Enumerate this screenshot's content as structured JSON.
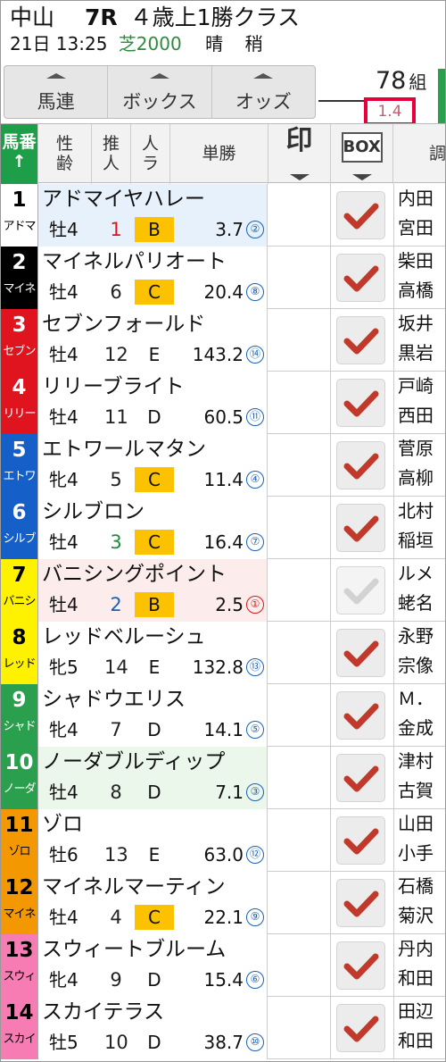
{
  "race": {
    "venue": "中山",
    "number": "7R",
    "cls": "４歳上1勝クラス",
    "date_time": "21日 13:25",
    "course": "芝2000",
    "weather": "晴",
    "track": "稍"
  },
  "toolbar": {
    "umaren": "馬連",
    "box": "ボックス",
    "odds": "オッズ"
  },
  "combos": {
    "count": "78",
    "unit": "組",
    "odds": "1.4"
  },
  "columns": {
    "umaban": "馬番↑",
    "seirei_1": "性",
    "seirei_2": "齢",
    "suijin_1": "推",
    "suijin_2": "人",
    "jinki_1": "人",
    "jinki_2": "ラ",
    "tansho": "単勝",
    "shirushi": "印",
    "box": "BOX",
    "jockey": "調"
  },
  "horses": [
    {
      "num": "1",
      "short": "アドマ",
      "name": "アドマイヤハレー",
      "sex_age": "牡4",
      "pop": "1",
      "rank": "B",
      "odds": "3.7",
      "ord": "②",
      "jockey": "内田",
      "trainer": "宮田",
      "color": "#ffffff",
      "fg": "#000",
      "bg": "#e6f1fb",
      "pop_color": "#d81818",
      "ord_red": false,
      "checked": true
    },
    {
      "num": "2",
      "short": "マイネ",
      "name": "マイネルパリオート",
      "sex_age": "牡4",
      "pop": "6",
      "rank": "C",
      "odds": "20.4",
      "ord": "⑧",
      "jockey": "柴田",
      "trainer": "高橋",
      "color": "#000000",
      "fg": "#fff",
      "bg": "#fff",
      "pop_color": "#222",
      "ord_red": false,
      "checked": true
    },
    {
      "num": "3",
      "short": "セブン",
      "name": "セブンフォールド",
      "sex_age": "牡4",
      "pop": "12",
      "rank": "E",
      "odds": "143.2",
      "ord": "⑭",
      "jockey": "坂井",
      "trainer": "黒岩",
      "color": "#e0141e",
      "fg": "#fff",
      "bg": "#fff",
      "pop_color": "#222",
      "ord_red": false,
      "checked": true
    },
    {
      "num": "4",
      "short": "リリー",
      "name": "リリーブライト",
      "sex_age": "牡4",
      "pop": "11",
      "rank": "D",
      "odds": "60.5",
      "ord": "⑪",
      "jockey": "戸崎",
      "trainer": "西田",
      "color": "#e0141e",
      "fg": "#fff",
      "bg": "#fff",
      "pop_color": "#222",
      "ord_red": false,
      "checked": true
    },
    {
      "num": "5",
      "short": "エトワ",
      "name": "エトワールマタン",
      "sex_age": "牝4",
      "pop": "5",
      "rank": "C",
      "odds": "11.4",
      "ord": "④",
      "jockey": "菅原",
      "trainer": "高柳",
      "color": "#1560c8",
      "fg": "#fff",
      "bg": "#fff",
      "pop_color": "#222",
      "ord_red": false,
      "checked": true
    },
    {
      "num": "6",
      "short": "シルブ",
      "name": "シルブロン",
      "sex_age": "牡4",
      "pop": "3",
      "rank": "C",
      "odds": "16.4",
      "ord": "⑦",
      "jockey": "北村",
      "trainer": "稲垣",
      "color": "#1560c8",
      "fg": "#fff",
      "bg": "#fff",
      "pop_color": "#1e8c3a",
      "ord_red": false,
      "checked": true
    },
    {
      "num": "7",
      "short": "バニシ",
      "name": "バニシングポイント",
      "sex_age": "牡4",
      "pop": "2",
      "rank": "B",
      "odds": "2.5",
      "ord": "①",
      "jockey": "ルメ",
      "trainer": "蛯名",
      "color": "#fff200",
      "fg": "#000",
      "bg": "#fcecec",
      "pop_color": "#1a62b8",
      "ord_red": true,
      "checked": false
    },
    {
      "num": "8",
      "short": "レッド",
      "name": "レッドベルーシュ",
      "sex_age": "牝5",
      "pop": "14",
      "rank": "E",
      "odds": "132.8",
      "ord": "⑬",
      "jockey": "永野",
      "trainer": "宗像",
      "color": "#fff200",
      "fg": "#000",
      "bg": "#fff",
      "pop_color": "#222",
      "ord_red": false,
      "checked": true
    },
    {
      "num": "9",
      "short": "シャド",
      "name": "シャドウエリス",
      "sex_age": "牝4",
      "pop": "7",
      "rank": "D",
      "odds": "14.1",
      "ord": "⑤",
      "jockey": "Ｍ．",
      "trainer": "金成",
      "color": "#2aa04e",
      "fg": "#fff",
      "bg": "#fff",
      "pop_color": "#222",
      "ord_red": false,
      "checked": true
    },
    {
      "num": "10",
      "short": "ノーダ",
      "name": "ノーダブルディップ",
      "sex_age": "牡4",
      "pop": "8",
      "rank": "D",
      "odds": "7.1",
      "ord": "③",
      "jockey": "津村",
      "trainer": "古賀",
      "color": "#2aa04e",
      "fg": "#fff",
      "bg": "#eaf7ea",
      "pop_color": "#222",
      "ord_red": false,
      "checked": true
    },
    {
      "num": "11",
      "short": "ゾロ",
      "name": "ゾロ",
      "sex_age": "牡6",
      "pop": "13",
      "rank": "E",
      "odds": "63.0",
      "ord": "⑫",
      "jockey": "山田",
      "trainer": "小手",
      "color": "#f39800",
      "fg": "#000",
      "bg": "#fff",
      "pop_color": "#222",
      "ord_red": false,
      "checked": true
    },
    {
      "num": "12",
      "short": "マイネ",
      "name": "マイネルマーティン",
      "sex_age": "牡4",
      "pop": "4",
      "rank": "C",
      "odds": "22.1",
      "ord": "⑨",
      "jockey": "石橋",
      "trainer": "菊沢",
      "color": "#f39800",
      "fg": "#000",
      "bg": "#fff",
      "pop_color": "#222",
      "ord_red": false,
      "checked": true
    },
    {
      "num": "13",
      "short": "スウィ",
      "name": "スウィートブルーム",
      "sex_age": "牝4",
      "pop": "9",
      "rank": "D",
      "odds": "15.4",
      "ord": "⑥",
      "jockey": "丹内",
      "trainer": "和田",
      "color": "#f77cb4",
      "fg": "#000",
      "bg": "#fff",
      "pop_color": "#222",
      "ord_red": false,
      "checked": true
    },
    {
      "num": "14",
      "short": "スカイ",
      "name": "スカイテラス",
      "sex_age": "牡5",
      "pop": "10",
      "rank": "D",
      "odds": "38.7",
      "ord": "⑩",
      "jockey": "田辺",
      "trainer": "和田",
      "color": "#f77cb4",
      "fg": "#000",
      "bg": "#fff",
      "pop_color": "#222",
      "ord_red": false,
      "checked": true
    }
  ]
}
